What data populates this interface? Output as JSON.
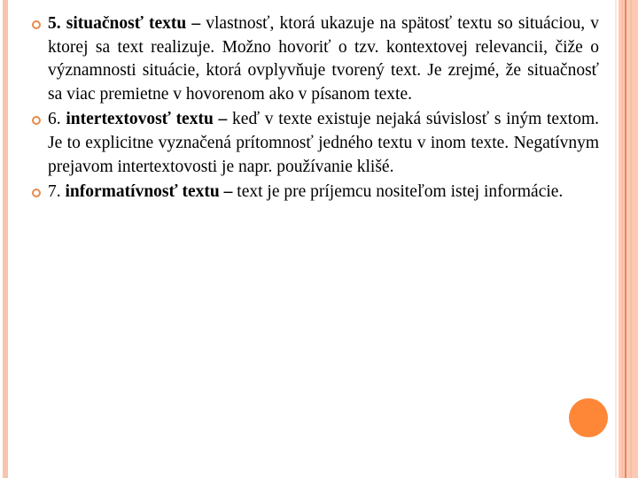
{
  "slide": {
    "colors": {
      "accent": "#fd8637",
      "bullet": "#e88a4c",
      "border_light": "#f9c3ae"
    },
    "items": [
      {
        "number": "5.",
        "term": "situačnosť textu –",
        "text": "vlastnosť, ktorá ukazuje na spätosť textu so situáciou, v ktorej sa text realizuje. Možno hovoriť o tzv. kontextovej relevancii, čiže o významnosti situácie, ktorá ovplyvňuje tvorený text. Je zrejmé, že situačnosť sa viac premietne v hovorenom ako v písanom texte."
      },
      {
        "number": "6.",
        "term": "intertextovosť textu –",
        "text": "keď v texte existuje nejaká súvislosť s iným textom. Je to explicitne vyznačená prítomnosť jedného textu v inom texte. Negatívnym prejavom intertextovosti je napr. používanie klišé."
      },
      {
        "number": "7.",
        "term": "informatívnosť textu –",
        "text": "text je pre príjemcu nositeľom istej informácie."
      }
    ]
  }
}
